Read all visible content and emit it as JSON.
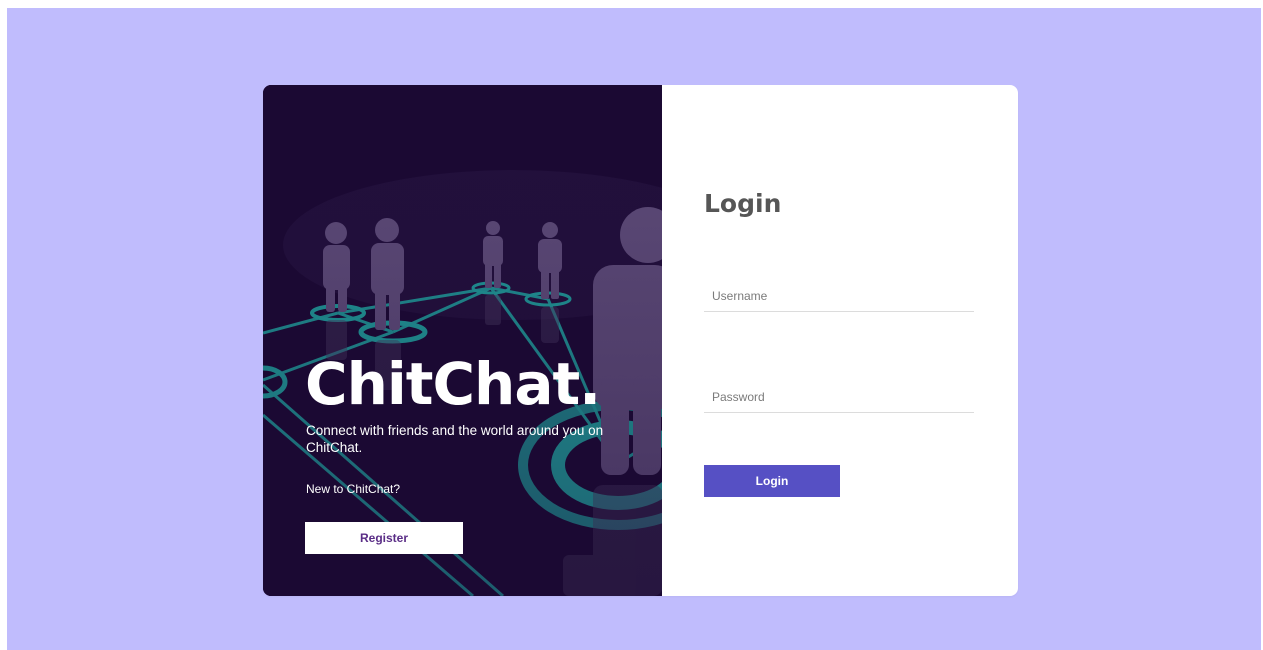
{
  "brand": {
    "name": "ChitChat.",
    "tagline": "Connect with friends and the world around you on ChitChat.",
    "new_user_prompt": "New to ChitChat?",
    "register_label": "Register"
  },
  "login": {
    "title": "Login",
    "username_placeholder": "Username",
    "username_value": "",
    "password_placeholder": "Password",
    "password_value": "",
    "button_label": "Login"
  },
  "colors": {
    "page_background": "#c0bcfd",
    "left_panel": "#1b0933",
    "login_button": "#5650c4",
    "register_text": "#5a2d86",
    "network_teal": "#1f9d9a",
    "figure": "#5f4d7a"
  },
  "icons": {
    "hero": "social-network-people-illustration"
  }
}
